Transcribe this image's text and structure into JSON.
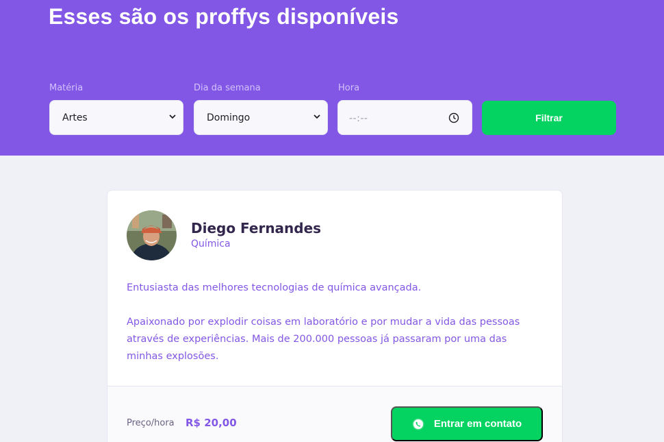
{
  "header": {
    "title": "Esses são os proffys disponíveis",
    "background_color": "#8257e5"
  },
  "filters": {
    "subject": {
      "label": "Matéria",
      "value": "Artes"
    },
    "weekday": {
      "label": "Dia da semana",
      "value": "Domingo"
    },
    "time": {
      "label": "Hora",
      "placeholder": "--:--",
      "icon": "clock-icon"
    },
    "submit_label": "Filtrar"
  },
  "teacher": {
    "name": "Diego Fernandes",
    "subject": "Química",
    "bio": [
      "Entusiasta das melhores tecnologias de química avançada.",
      "Apaixonado por explodir coisas em laboratório e por mudar a vida das pessoas através de experiências. Mais de 200.000 pessoas já passaram por uma das minhas explosões."
    ],
    "price_label": "Preço/hora",
    "price_value": "R$ 20,00",
    "contact_label": "Entrar em contato",
    "contact_icon": "whatsapp-icon"
  },
  "colors": {
    "primary": "#8257e5",
    "secondary": "#04d361",
    "background": "#f0f0f7",
    "title_text": "#32264d"
  }
}
